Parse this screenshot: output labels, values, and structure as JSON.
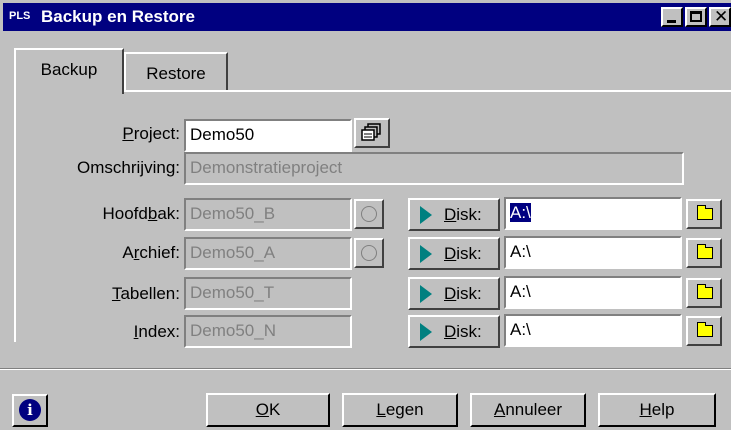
{
  "window": {
    "app_icon": "PLS",
    "title": "Backup en Restore"
  },
  "tabs": [
    {
      "label": "Backup",
      "active": true
    },
    {
      "label": "Restore",
      "active": false
    }
  ],
  "form": {
    "project_label": "Project:",
    "project_value": "Demo50",
    "description_label": "Omschrijving:",
    "description_value": "Demonstratieproject"
  },
  "rows": [
    {
      "label": "Hoofdbak:",
      "value": "Demo50_B",
      "disk_label": "Disk:",
      "path": "A:\\",
      "path_selected": true,
      "has_radio": true
    },
    {
      "label": "Archief:",
      "value": "Demo50_A",
      "disk_label": "Disk:",
      "path": "A:\\",
      "path_selected": false,
      "has_radio": true
    },
    {
      "label": "Tabellen:",
      "value": "Demo50_T",
      "disk_label": "Disk:",
      "path": "A:\\",
      "path_selected": false,
      "has_radio": false
    },
    {
      "label": "Index:",
      "value": "Demo50_N",
      "disk_label": "Disk:",
      "path": "A:\\",
      "path_selected": false,
      "has_radio": false
    }
  ],
  "buttons": {
    "ok": "OK",
    "clear": "Legen",
    "cancel": "Annuleer",
    "help": "Help"
  },
  "icons": {
    "info": "info-icon",
    "browse": "folder-icon",
    "project": "project-stack-icon"
  },
  "colors": {
    "title_bar": "#000080",
    "accent_arrow": "#008080",
    "folder": "#ffff00",
    "face": "#c0c0c0"
  }
}
